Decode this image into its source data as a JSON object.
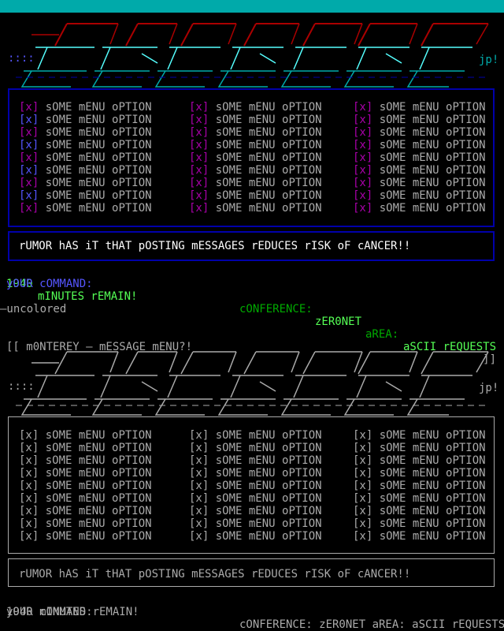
{
  "colored": {
    "title": "[[ m0NTEREY — mESSAGE mENU?!",
    "title_end": "]]",
    "logo_left": "::::",
    "logo_sig": "jp!",
    "menu_check": "[x]",
    "menu_label": "sOME mENU oPTION",
    "rumor": "rUMOR hAS iT tHAT pOSTING mESSAGES rEDUCES rISK oF cANCER!!",
    "minutes_num": "1940",
    "minutes_text": "mINUTES rEMAIN!",
    "conf_label": "cONFERENCE:",
    "conf_value": "zER0NET",
    "area_label": "aREA:",
    "area_value": "aSCII rEQUESTS",
    "command_prompt": "yOUR cOMMAND:"
  },
  "divider_label": "—uncolored",
  "uncolored": {
    "title": "[[ m0NTEREY — mESSAGE mENU?!",
    "title_end": "]]",
    "logo_left": "::::",
    "logo_sig": "jp!",
    "menu_check": "[x]",
    "menu_label": "sOME mENU oPTION",
    "rumor": "rUMOR hAS iT tHAT pOSTING mESSAGES rEDUCES rISK oF cANCER!!",
    "status_left": "1940 mINUTES rEMAIN!",
    "status_right": "cONFERENCE: zER0NET aREA: aSCII rEQUESTS",
    "command_prompt": "yOUR cOMMAND:"
  },
  "colors": {
    "title_bg": "#00aaaa",
    "box_border": "#0000aa",
    "logo_top": "#aa0000",
    "logo_mid": "#55ffff",
    "logo_bottom": "#00aaaa",
    "check": "#aa00aa",
    "label": "#aaaaaa",
    "minutes": "#55ff55",
    "command": "#5555ff"
  }
}
